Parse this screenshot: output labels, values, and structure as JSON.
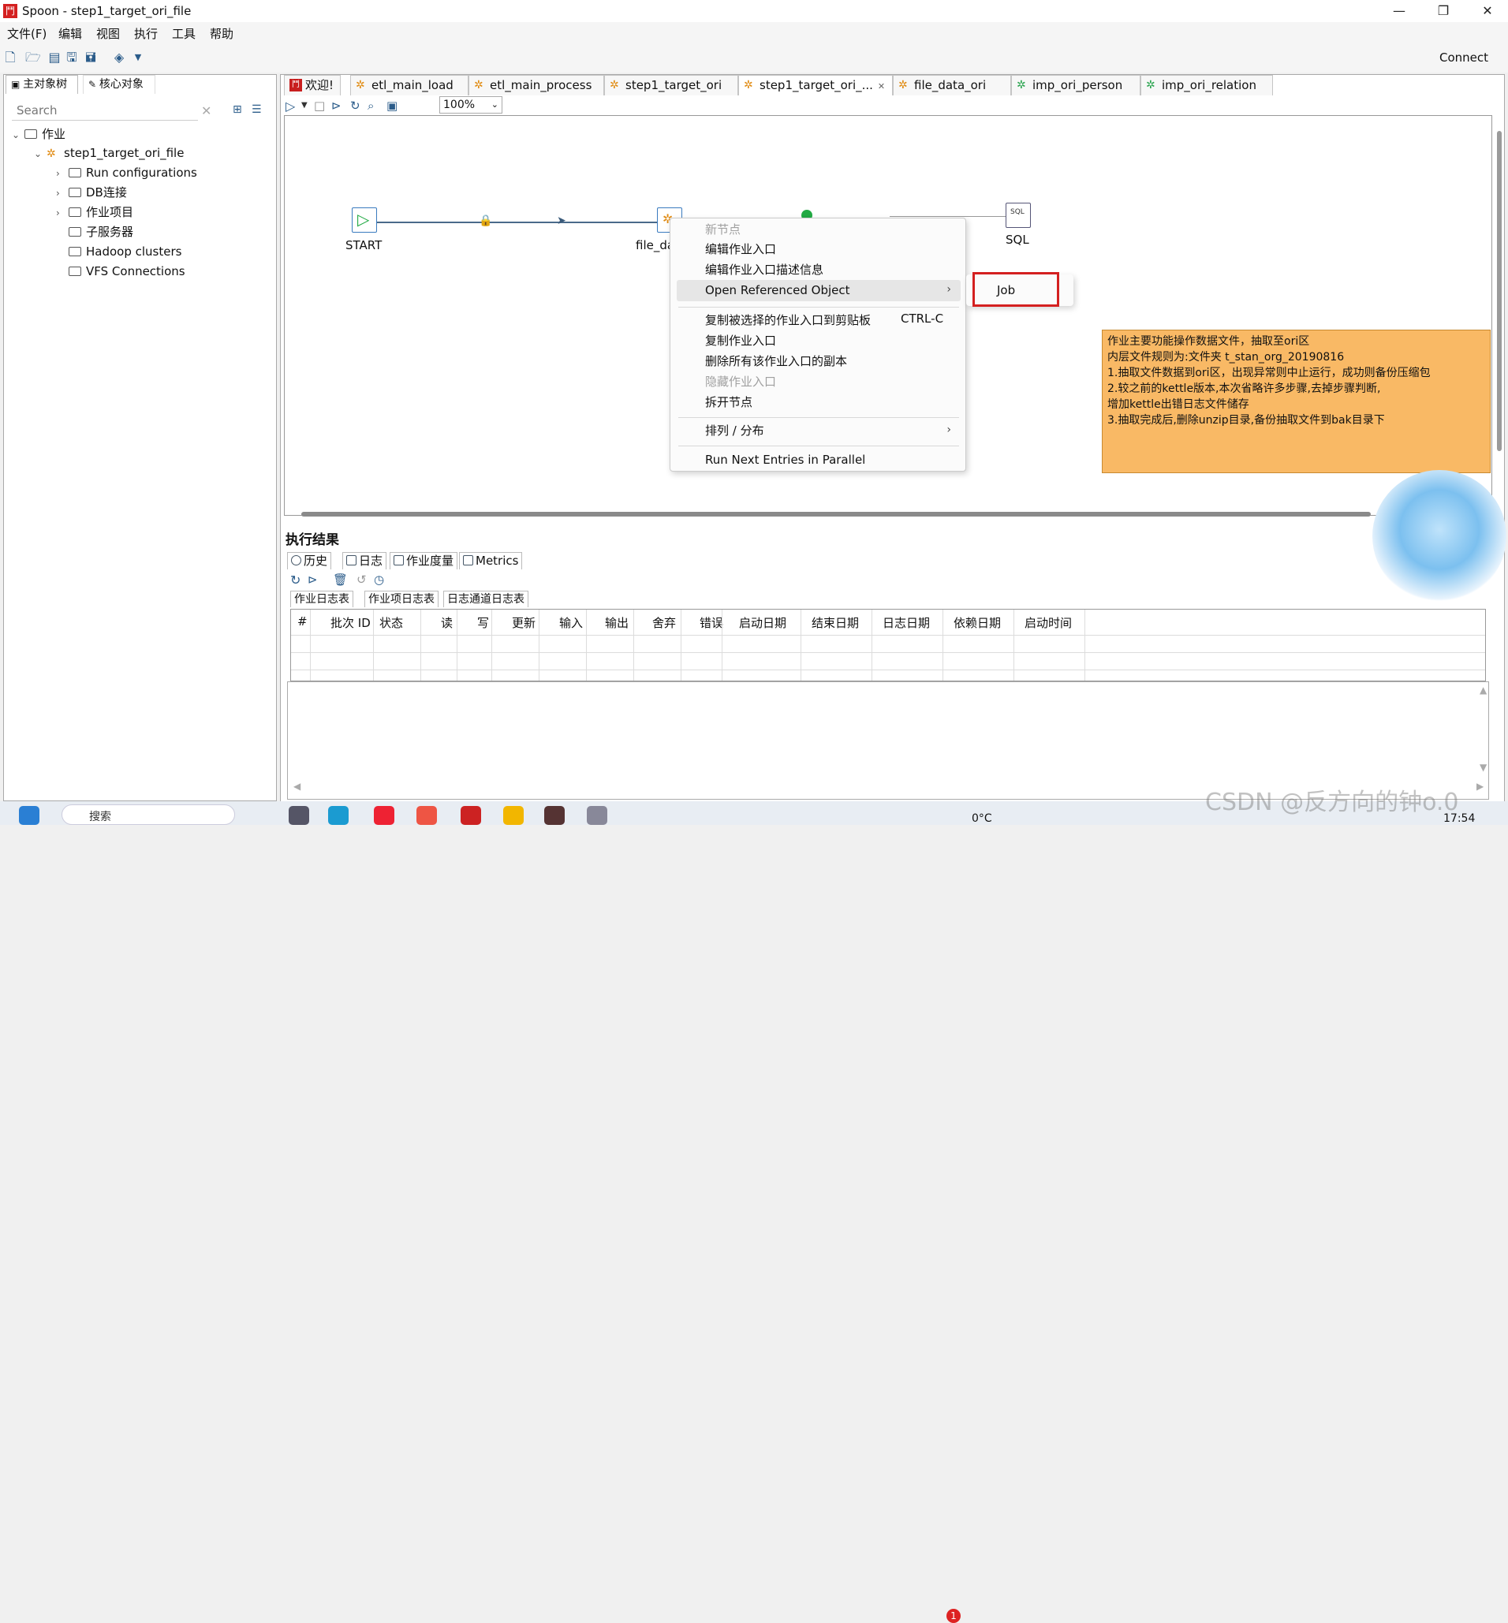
{
  "window": {
    "title": "Spoon - step1_target_ori_file",
    "app_icon": "spoon-icon"
  },
  "menubar": [
    "文件(F)",
    "编辑",
    "视图",
    "执行",
    "工具",
    "帮助"
  ],
  "toolbar": {
    "connect_label": "Connect"
  },
  "left_panel": {
    "tabs": [
      "主对象树",
      "核心对象"
    ],
    "search_placeholder": "Search",
    "tree": {
      "root": "作业",
      "job": "step1_target_ori_file",
      "children": [
        "Run configurations",
        "DB连接",
        "作业项目",
        "子服务器",
        "Hadoop clusters",
        "VFS Connections"
      ]
    }
  },
  "editor": {
    "tabs": [
      "欢迎!",
      "etl_main_load",
      "etl_main_process",
      "step1_target_ori",
      "step1_target_ori_...",
      "file_data_ori",
      "imp_ori_person",
      "imp_ori_relation"
    ],
    "zoom": "100%"
  },
  "canvas": {
    "nodes": {
      "start": "START",
      "file": "file_da",
      "sql": "SQL"
    },
    "note_lines": [
      "作业主要功能操作数据文件，抽取至ori区",
      "内层文件规则为:文件夹 t_stan_org_20190816",
      "1.抽取文件数据到ori区，出现异常则中止运行，成功则备份压缩包",
      "2.较之前的kettle版本,本次省略许多步骤,去掉步骤判断,",
      "增加kettle出错日志文件储存",
      "3.抽取完成后,删除unzip目录,备份抽取文件到bak目录下"
    ]
  },
  "context_menu": {
    "header": "新节点",
    "items": {
      "edit_entry": "编辑作业入口",
      "edit_desc": "编辑作业入口描述信息",
      "open_ref": "Open Referenced Object",
      "copy_selected": "复制被选择的作业入口到剪贴板",
      "copy_shortcut": "CTRL-C",
      "copy_entry": "复制作业入口",
      "delete_copies": "删除所有该作业入口的副本",
      "hide_entry": "隐藏作业入口",
      "detach": "拆开节点",
      "arrange": "排列 / 分布",
      "run_parallel": "Run Next Entries in Parallel"
    },
    "submenu_item": "Job"
  },
  "results": {
    "title": "执行结果",
    "tabs": [
      "历史",
      "日志",
      "作业度量",
      "Metrics"
    ],
    "subtabs": [
      "作业日志表",
      "作业项日志表",
      "日志通道日志表"
    ],
    "columns": [
      "#",
      "批次 ID",
      "状态",
      "读",
      "写",
      "更新",
      "输入",
      "输出",
      "舍弃",
      "错误",
      "启动日期",
      "结束日期",
      "日志日期",
      "依赖日期",
      "启动时间"
    ]
  },
  "taskbar": {
    "search": "搜索",
    "temperature": "0°C",
    "clock": "17:54",
    "badge": "1"
  },
  "watermark": "CSDN @反方向的钟o.0"
}
